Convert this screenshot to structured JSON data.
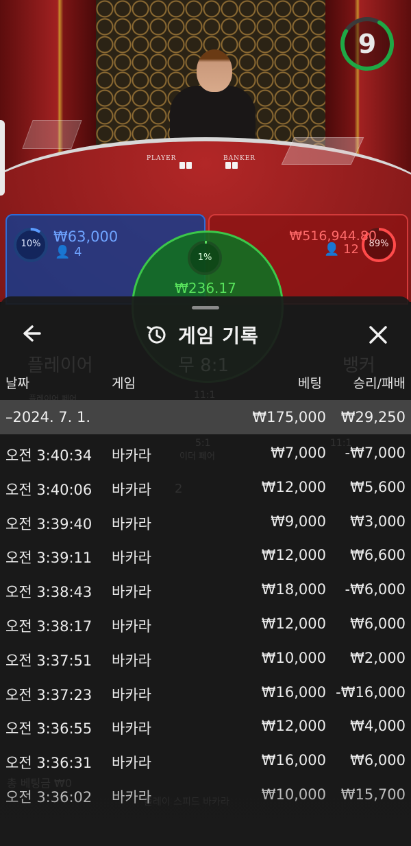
{
  "live": {
    "timer": "9",
    "table_labels": {
      "player": "PLAYER",
      "banker": "BANKER"
    },
    "player_bet": {
      "percent": "10%",
      "amount": "₩63,000",
      "count": "4"
    },
    "banker_bet": {
      "percent": "89%",
      "amount": "₩516,944.80",
      "count": "12"
    },
    "tie_bet": {
      "percent": "1%",
      "amount": "₩236.17"
    }
  },
  "background": {
    "player_label": "플레이어",
    "tie_label": "무 8:1",
    "banker_label": "뱅커",
    "player_pair_label": "플레이어 페어",
    "tie_ratio": "11:1",
    "either_ratio": "5:1",
    "either_pair": "이더 페어",
    "banker_ratio": "11:1",
    "player_counter": "2",
    "bottom_total": "총 베팅금 ₩0",
    "bottom_game": "플레이 스피드 바카라"
  },
  "history": {
    "title": "게임 기록",
    "columns": {
      "date": "날짜",
      "game": "게임",
      "bet": "베팅",
      "result": "승리/패배"
    },
    "date_group": {
      "date": "–2024. 7. 1.",
      "bet": "₩175,000",
      "result": "₩29,250"
    },
    "rows": [
      {
        "time": "오전 3:40:34",
        "game": "바카라",
        "bet": "₩7,000",
        "result": "-₩7,000"
      },
      {
        "time": "오전 3:40:06",
        "game": "바카라",
        "bet": "₩12,000",
        "result": "₩5,600"
      },
      {
        "time": "오전 3:39:40",
        "game": "바카라",
        "bet": "₩9,000",
        "result": "₩3,000"
      },
      {
        "time": "오전 3:39:11",
        "game": "바카라",
        "bet": "₩12,000",
        "result": "₩6,600"
      },
      {
        "time": "오전 3:38:43",
        "game": "바카라",
        "bet": "₩18,000",
        "result": "-₩6,000"
      },
      {
        "time": "오전 3:38:17",
        "game": "바카라",
        "bet": "₩12,000",
        "result": "₩6,000"
      },
      {
        "time": "오전 3:37:51",
        "game": "바카라",
        "bet": "₩10,000",
        "result": "₩2,000"
      },
      {
        "time": "오전 3:37:23",
        "game": "바카라",
        "bet": "₩16,000",
        "result": "-₩16,000"
      },
      {
        "time": "오전 3:36:55",
        "game": "바카라",
        "bet": "₩12,000",
        "result": "₩4,000"
      },
      {
        "time": "오전 3:36:31",
        "game": "바카라",
        "bet": "₩16,000",
        "result": "₩6,000"
      },
      {
        "time": "오전 3:36:02",
        "game": "바카라",
        "bet": "₩10,000",
        "result": "₩15,700"
      }
    ]
  },
  "colors": {
    "player_blue": "#2e6bd6",
    "banker_red": "#d33a3a",
    "tie_green": "#3cc84a",
    "timer_green": "#1fa845",
    "sheet_bg": "#1a1a1a",
    "date_row_bg": "#444444"
  },
  "icons": {
    "back": "arrow-left-icon",
    "history": "history-clock-icon",
    "close": "close-icon"
  }
}
